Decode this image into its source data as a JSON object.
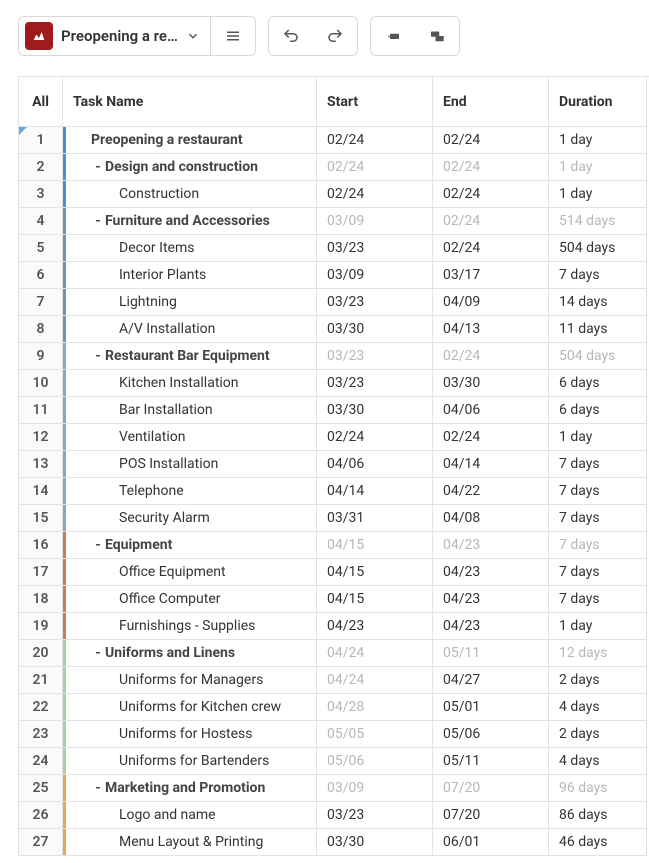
{
  "toolbar": {
    "project_name": "Preopening a re…"
  },
  "headers": {
    "all": "All",
    "task": "Task Name",
    "start": "Start",
    "end": "End",
    "duration": "Duration"
  },
  "rows": [
    {
      "n": 1,
      "name": "Preopening a restaurant",
      "start": "02/24",
      "end": "02/24",
      "dur": "1 day",
      "level": 0,
      "summary": true,
      "dim": false,
      "color": "#4a90d9",
      "toggle": ""
    },
    {
      "n": 2,
      "name": "Design and construction",
      "start": "02/24",
      "end": "02/24",
      "dur": "1 day",
      "level": 1,
      "summary": true,
      "dim": true,
      "color": "#4a90d9",
      "toggle": "-"
    },
    {
      "n": 3,
      "name": "Construction",
      "start": "02/24",
      "end": "02/24",
      "dur": "1 day",
      "level": 2,
      "summary": false,
      "dim": false,
      "color": "#4a90d9",
      "toggle": ""
    },
    {
      "n": 4,
      "name": "Furniture and Accessories",
      "start": "03/09",
      "end": "02/24",
      "dur": "514 days",
      "level": 1,
      "summary": true,
      "dim": true,
      "color": "#7a8fb0",
      "toggle": "-"
    },
    {
      "n": 5,
      "name": "Decor Items",
      "start": "03/23",
      "end": "02/24",
      "dur": "504 days",
      "level": 2,
      "summary": false,
      "dim": false,
      "color": "#7a8fb0",
      "toggle": ""
    },
    {
      "n": 6,
      "name": "Interior Plants",
      "start": "03/09",
      "end": "03/17",
      "dur": "7 days",
      "level": 2,
      "summary": false,
      "dim": false,
      "color": "#7a8fb0",
      "toggle": ""
    },
    {
      "n": 7,
      "name": "Lightning",
      "start": "03/23",
      "end": "04/09",
      "dur": "14 days",
      "level": 2,
      "summary": false,
      "dim": false,
      "color": "#7a8fb0",
      "toggle": ""
    },
    {
      "n": 8,
      "name": "A/V Installation",
      "start": "03/30",
      "end": "04/13",
      "dur": "11 days",
      "level": 2,
      "summary": false,
      "dim": false,
      "color": "#7a8fb0",
      "toggle": ""
    },
    {
      "n": 9,
      "name": "Restaurant Bar Equipment",
      "start": "03/23",
      "end": "02/24",
      "dur": "504 days",
      "level": 1,
      "summary": true,
      "dim": true,
      "color": "#8fa6bf",
      "toggle": "-"
    },
    {
      "n": 10,
      "name": "Kitchen Installation",
      "start": "03/23",
      "end": "03/30",
      "dur": "6 days",
      "level": 2,
      "summary": false,
      "dim": false,
      "color": "#8fa6bf",
      "toggle": ""
    },
    {
      "n": 11,
      "name": "Bar Installation",
      "start": "03/30",
      "end": "04/06",
      "dur": "6 days",
      "level": 2,
      "summary": false,
      "dim": false,
      "color": "#8fa6bf",
      "toggle": ""
    },
    {
      "n": 12,
      "name": "Ventilation",
      "start": "02/24",
      "end": "02/24",
      "dur": "1 day",
      "level": 2,
      "summary": false,
      "dim": false,
      "color": "#8fa6bf",
      "toggle": ""
    },
    {
      "n": 13,
      "name": "POS Installation",
      "start": "04/06",
      "end": "04/14",
      "dur": "7 days",
      "level": 2,
      "summary": false,
      "dim": false,
      "color": "#8fa6bf",
      "toggle": ""
    },
    {
      "n": 14,
      "name": "Telephone",
      "start": "04/14",
      "end": "04/22",
      "dur": "7 days",
      "level": 2,
      "summary": false,
      "dim": false,
      "color": "#8fa6bf",
      "toggle": ""
    },
    {
      "n": 15,
      "name": "Security Alarm",
      "start": "03/31",
      "end": "04/08",
      "dur": "7 days",
      "level": 2,
      "summary": false,
      "dim": false,
      "color": "#8fa6bf",
      "toggle": ""
    },
    {
      "n": 16,
      "name": "Equipment",
      "start": "04/15",
      "end": "04/23",
      "dur": "7 days",
      "level": 1,
      "summary": true,
      "dim": true,
      "color": "#c77b5a",
      "toggle": "-"
    },
    {
      "n": 17,
      "name": "Office Equipment",
      "start": "04/15",
      "end": "04/23",
      "dur": "7 days",
      "level": 2,
      "summary": false,
      "dim": false,
      "color": "#c77b5a",
      "toggle": ""
    },
    {
      "n": 18,
      "name": "Office Computer",
      "start": "04/15",
      "end": "04/23",
      "dur": "7 days",
      "level": 2,
      "summary": false,
      "dim": false,
      "color": "#c77b5a",
      "toggle": ""
    },
    {
      "n": 19,
      "name": "Furnishings - Supplies",
      "start": "04/23",
      "end": "04/23",
      "dur": "1 day",
      "level": 2,
      "summary": false,
      "dim": false,
      "color": "#c77b5a",
      "toggle": ""
    },
    {
      "n": 20,
      "name": "Uniforms and Linens",
      "start": "04/24",
      "end": "05/11",
      "dur": "12 days",
      "level": 1,
      "summary": true,
      "dim": true,
      "color": "#a9cdaa",
      "toggle": "-"
    },
    {
      "n": 21,
      "name": "Uniforms for Managers",
      "start": "04/24",
      "end": "04/27",
      "dur": "2 days",
      "level": 2,
      "summary": false,
      "dim": false,
      "color": "#a9cdaa",
      "toggle": "",
      "dimStart": true
    },
    {
      "n": 22,
      "name": "Uniforms for Kitchen crew",
      "start": "04/28",
      "end": "05/01",
      "dur": "4 days",
      "level": 2,
      "summary": false,
      "dim": false,
      "color": "#a9cdaa",
      "toggle": "",
      "dimStart": true
    },
    {
      "n": 23,
      "name": "Uniforms for Hostess",
      "start": "05/05",
      "end": "05/06",
      "dur": "2 days",
      "level": 2,
      "summary": false,
      "dim": false,
      "color": "#a9cdaa",
      "toggle": "",
      "dimStart": true
    },
    {
      "n": 24,
      "name": "Uniforms for Bartenders",
      "start": "05/06",
      "end": "05/11",
      "dur": "4 days",
      "level": 2,
      "summary": false,
      "dim": false,
      "color": "#a9cdaa",
      "toggle": "",
      "dimStart": true
    },
    {
      "n": 25,
      "name": "Marketing and Promotion",
      "start": "03/09",
      "end": "07/20",
      "dur": "96 days",
      "level": 1,
      "summary": true,
      "dim": true,
      "color": "#e6a84d",
      "toggle": "-"
    },
    {
      "n": 26,
      "name": "Logo and name",
      "start": "03/23",
      "end": "07/20",
      "dur": "86 days",
      "level": 2,
      "summary": false,
      "dim": false,
      "color": "#e6a84d",
      "toggle": ""
    },
    {
      "n": 27,
      "name": "Menu Layout & Printing",
      "start": "03/30",
      "end": "06/01",
      "dur": "46 days",
      "level": 2,
      "summary": false,
      "dim": false,
      "color": "#e6a84d",
      "toggle": ""
    }
  ]
}
